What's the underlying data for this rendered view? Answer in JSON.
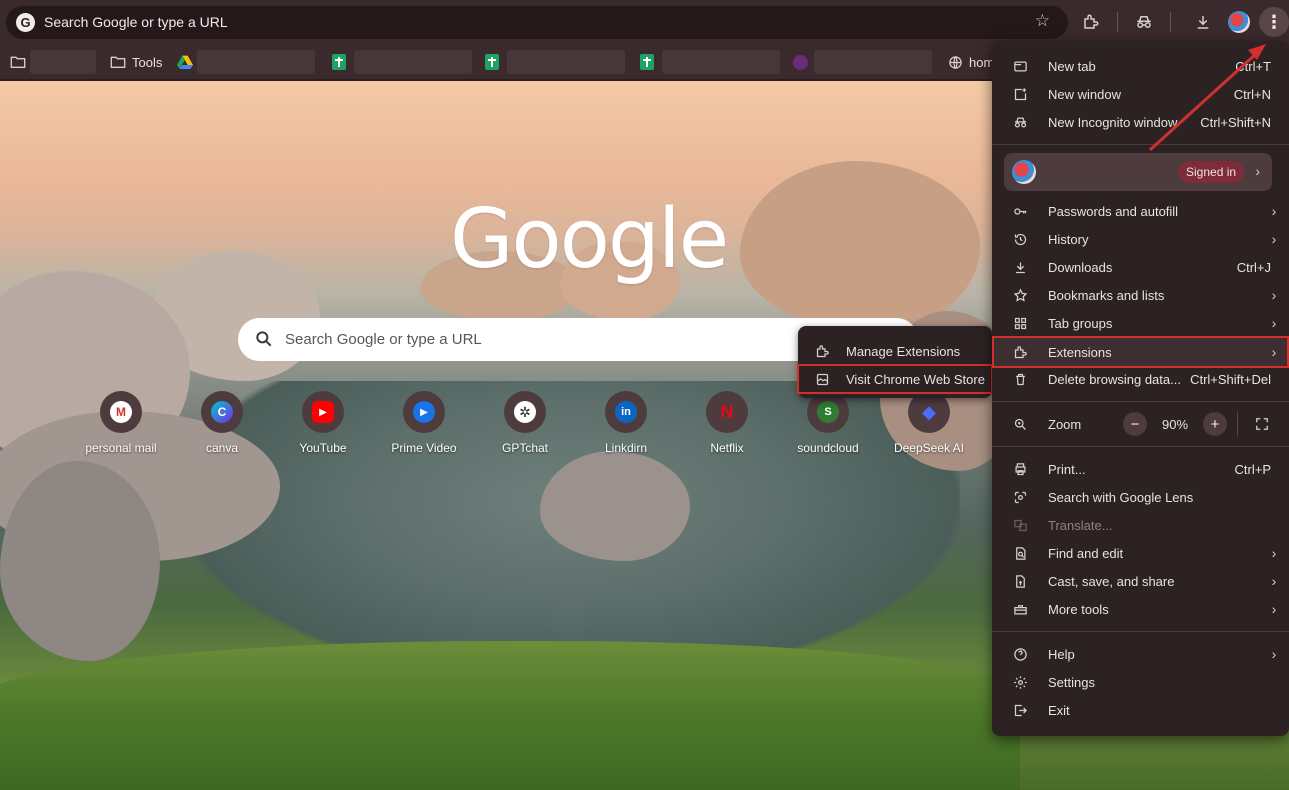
{
  "toolbar": {
    "omnibox_placeholder": "Search Google or type a URL",
    "omnibox_logo": "G"
  },
  "bookmarks": {
    "tools_label": "Tools",
    "home_label": "hom"
  },
  "ntp": {
    "logo_text": "Google",
    "search_placeholder": "Search Google or type a URL",
    "shortcuts": [
      {
        "label": "personal mail",
        "glyph": "M",
        "color": "#d93025"
      },
      {
        "label": "canva",
        "glyph": "C",
        "color": "#7d2ae8"
      },
      {
        "label": "YouTube",
        "glyph": "▶",
        "color": "#ff0000"
      },
      {
        "label": "Prime Video",
        "glyph": "▶",
        "color": "#1a73e8"
      },
      {
        "label": "GPTchat",
        "glyph": "✲",
        "color": "#2b2b2b"
      },
      {
        "label": "Linkdirn",
        "glyph": "in",
        "color": "#0a66c2"
      },
      {
        "label": "Netflix",
        "glyph": "N",
        "color": "#b20710"
      },
      {
        "label": "soundcloud",
        "glyph": "S",
        "color": "#2e7d32"
      },
      {
        "label": "DeepSeek AI",
        "glyph": "◆",
        "color": "#4d6bfe"
      }
    ]
  },
  "submenu": {
    "manage_extensions": "Manage Extensions",
    "visit_store": "Visit Chrome Web Store"
  },
  "menu": {
    "new_tab": {
      "label": "New tab",
      "shortcut": "Ctrl+T"
    },
    "new_window": {
      "label": "New window",
      "shortcut": "Ctrl+N"
    },
    "new_incognito": {
      "label": "New Incognito window",
      "shortcut": "Ctrl+Shift+N"
    },
    "profile_status": "Signed in",
    "passwords": {
      "label": "Passwords and autofill"
    },
    "history": {
      "label": "History"
    },
    "downloads": {
      "label": "Downloads",
      "shortcut": "Ctrl+J"
    },
    "bookmarks": {
      "label": "Bookmarks and lists"
    },
    "tab_groups": {
      "label": "Tab groups"
    },
    "extensions": {
      "label": "Extensions"
    },
    "delete_data": {
      "label": "Delete browsing data...",
      "shortcut": "Ctrl+Shift+Del"
    },
    "zoom": {
      "label": "Zoom",
      "value": "90%",
      "minus": "−",
      "plus": "+"
    },
    "print": {
      "label": "Print...",
      "shortcut": "Ctrl+P"
    },
    "lens": {
      "label": "Search with Google Lens"
    },
    "translate": {
      "label": "Translate..."
    },
    "find_edit": {
      "label": "Find and edit"
    },
    "cast": {
      "label": "Cast, save, and share"
    },
    "more_tools": {
      "label": "More tools"
    },
    "help": {
      "label": "Help"
    },
    "settings": {
      "label": "Settings"
    },
    "exit": {
      "label": "Exit"
    }
  },
  "colors": {
    "highlight": "#d32f2f",
    "menu_bg": "#2d2223",
    "toolbar_bg": "#3b2a2d"
  }
}
